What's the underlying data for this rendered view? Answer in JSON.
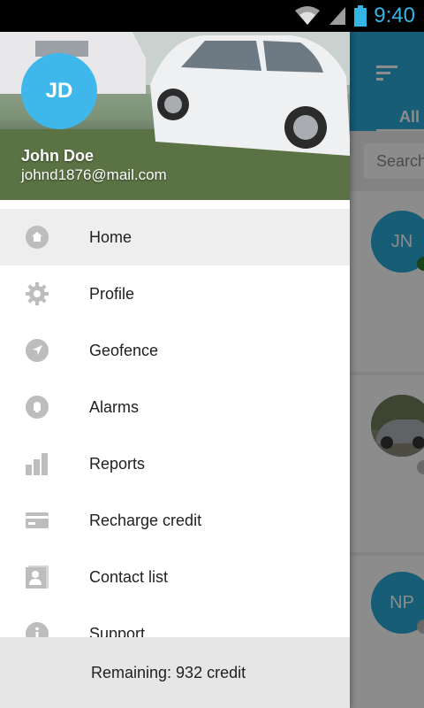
{
  "status_bar": {
    "time": "9:40",
    "icons": [
      "wifi-icon",
      "signal-icon",
      "battery-icon"
    ]
  },
  "drawer": {
    "avatar_initials": "JD",
    "user_name": "John Doe",
    "user_email": "johnd1876@mail.com",
    "menu": [
      {
        "label": "Home",
        "icon": "home-icon",
        "active": true
      },
      {
        "label": "Profile",
        "icon": "gear-icon"
      },
      {
        "label": "Geofence",
        "icon": "navigation-icon"
      },
      {
        "label": "Alarms",
        "icon": "bell-icon"
      },
      {
        "label": "Reports",
        "icon": "bar-chart-icon"
      },
      {
        "label": "Recharge credit",
        "icon": "credit-card-icon"
      },
      {
        "label": "Contact list",
        "icon": "contacts-icon"
      },
      {
        "label": "Support",
        "icon": "info-icon"
      }
    ],
    "footer_text": "Remaining:  932 credit"
  },
  "background": {
    "tab_label": "All (",
    "search_placeholder": "Search",
    "contacts": [
      {
        "initials": "JN",
        "status_color": "#2e7d32"
      },
      {
        "initials": "",
        "photo": true,
        "status_color": "#bdbdbd"
      },
      {
        "initials": "NP",
        "status_color": "#bdbdbd"
      }
    ]
  },
  "colors": {
    "accent": "#2aa9d6",
    "avatar": "#3fb7ea",
    "icon_gray": "#bdbdbd"
  }
}
